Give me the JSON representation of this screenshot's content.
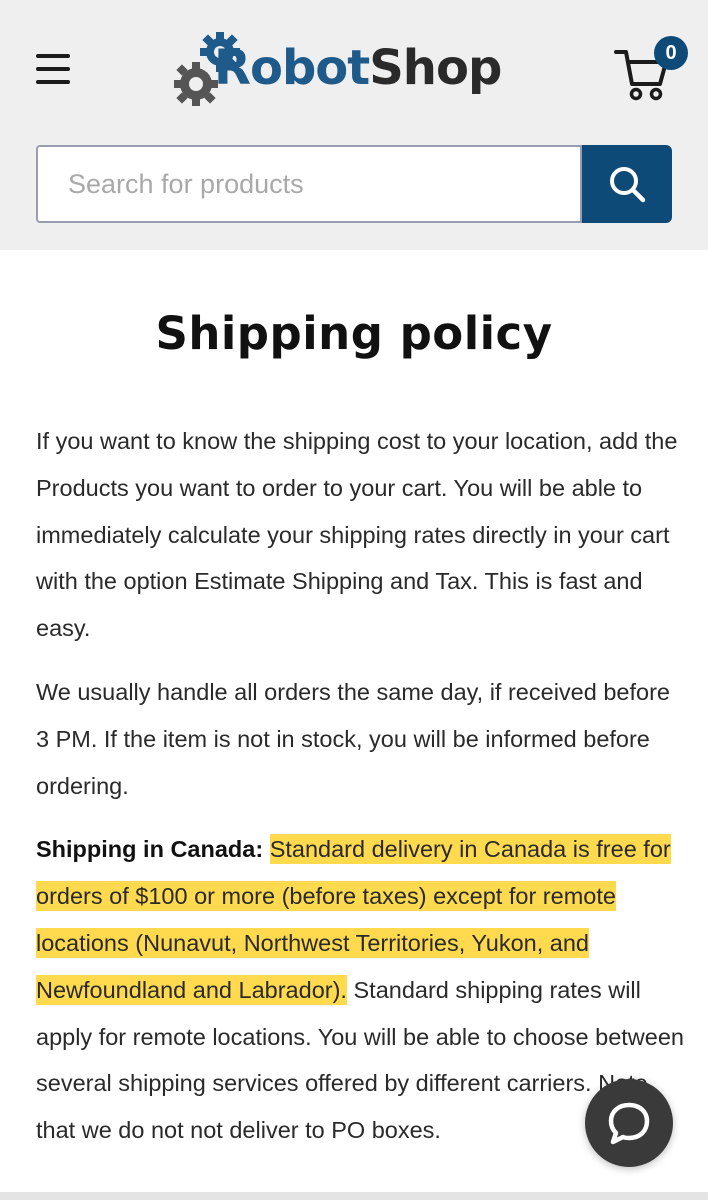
{
  "header": {
    "logo": {
      "part1": "Robot",
      "part2": "Shop"
    },
    "cart": {
      "count": "0"
    },
    "search": {
      "placeholder": "Search for products"
    }
  },
  "page": {
    "title": "Shipping policy",
    "paragraphs": {
      "p1": "If you want to know the shipping cost to your location, add the Products you want to order to your cart. You will be able to immediately calculate your shipping rates directly in your cart with the option Estimate Shipping and Tax. This is fast and easy.",
      "p2": "We usually handle all orders the same day, if received before 3 PM. If the item is not in stock, you will be informed before ordering.",
      "p3_label": "Shipping in Canada:",
      "p3_highlight": "Standard delivery in Canada is free for orders of $100 or more (before taxes) except for remote locations (Nunavut, Northwest Territories, Yukon, and Newfoundland and Labrador).",
      "p3_rest": "Standard shipping rates will apply for remote locations. You will be able to choose between several shipping services offered by different carriers. Note that we do not not deliver to PO boxes."
    }
  },
  "colors": {
    "brand": "#0d4a78",
    "highlight": "#ffd228",
    "header_bg": "#efefef",
    "chat_button": "#3a3a3a"
  },
  "icons": {
    "menu": "menu-icon",
    "logo_gear": "gear-icon",
    "cart": "cart-icon",
    "search": "search-icon",
    "chat": "chat-bubble-icon"
  }
}
